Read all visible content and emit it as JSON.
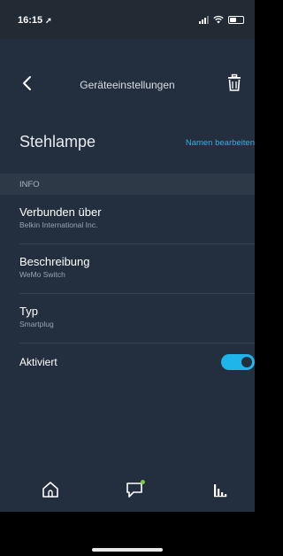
{
  "status_bar": {
    "time": "16:15"
  },
  "header": {
    "title": "Geräteeinstellungen"
  },
  "device": {
    "name": "Stehlampe",
    "edit_label": "Namen bearbeiten"
  },
  "section": {
    "label": "INFO"
  },
  "rows": [
    {
      "label": "Verbunden über",
      "value": "Belkin International Inc."
    },
    {
      "label": "Beschreibung",
      "value": "WeMo Switch"
    },
    {
      "label": "Typ",
      "value": "Smartplug"
    }
  ],
  "enabled": {
    "label": "Aktiviert",
    "state": true
  },
  "colors": {
    "accent": "#1fb5ea",
    "background": "#232f3e",
    "notification": "#7ec83b"
  },
  "icons": {
    "back": "chevron-left-icon",
    "delete": "trash-icon",
    "home": "home-icon",
    "communicate": "chat-bubble-icon",
    "devices": "devices-icon"
  }
}
